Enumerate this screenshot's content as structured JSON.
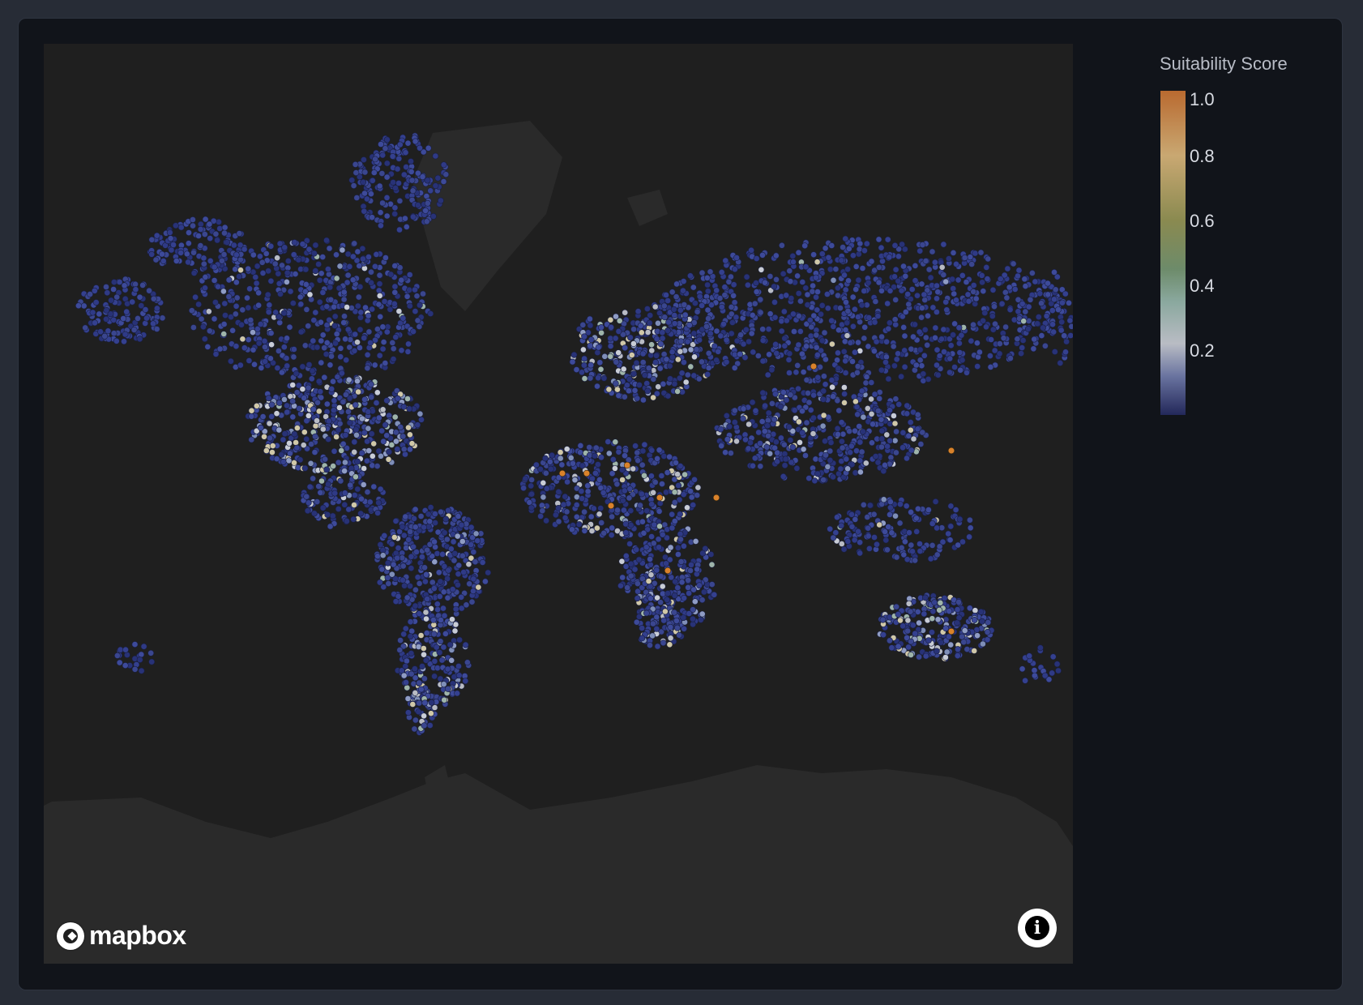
{
  "legend": {
    "title": "Suitability Score",
    "ticks": [
      "1.0",
      "0.8",
      "0.6",
      "0.4",
      "0.2"
    ],
    "tick_values": [
      1.0,
      0.8,
      0.6,
      0.4,
      0.2
    ],
    "range": [
      0.0,
      1.0
    ],
    "colorscale": [
      "#23285a",
      "#6a74a0",
      "#b9bcc4",
      "#8aa89e",
      "#6d8b6a",
      "#8a8a50",
      "#c9a872",
      "#b96a30"
    ]
  },
  "map": {
    "attribution_logo": "mapbox",
    "info_icon": "info-icon",
    "land_color": "#2a2a2a",
    "water_color": "#1f1f1f",
    "point_base_color": "#2f3a86"
  }
}
